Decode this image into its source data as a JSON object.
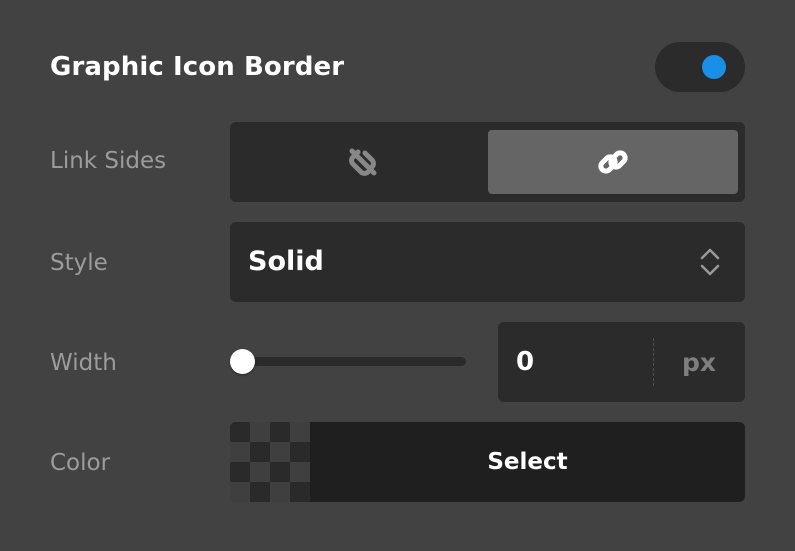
{
  "section": {
    "title": "Graphic Icon Border",
    "enabled": true
  },
  "link_sides": {
    "label": "Link Sides",
    "options": [
      {
        "icon": "unlink-icon",
        "active": false
      },
      {
        "icon": "link-icon",
        "active": true
      }
    ]
  },
  "style": {
    "label": "Style",
    "value": "Solid"
  },
  "width": {
    "label": "Width",
    "value": "0",
    "unit": "px",
    "slider_fraction": 0
  },
  "color": {
    "label": "Color",
    "button_label": "Select"
  },
  "colors": {
    "background": "#424242",
    "control": "#2b2b2b",
    "active_segment": "#656565",
    "toggle_knob": "#1a8fe8",
    "label": "#9c9c9c"
  }
}
